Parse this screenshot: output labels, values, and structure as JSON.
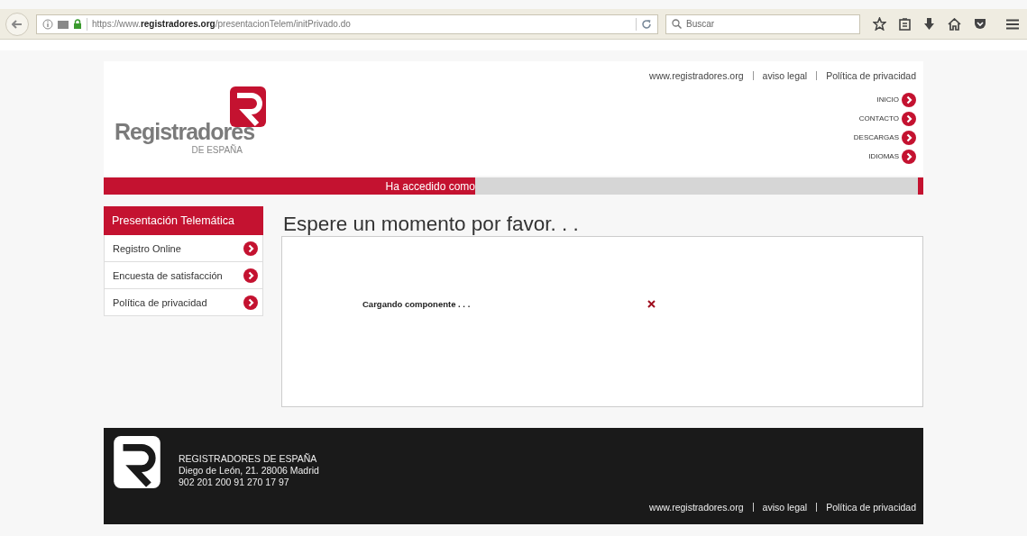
{
  "browser": {
    "url": "https://www.**registradores.org**/presentacionTelem/initPrivado.do",
    "search": {
      "placeholder": "Buscar"
    }
  },
  "header": {
    "top_links": [
      "www.registradores.org",
      "aviso legal",
      "Política de privacidad"
    ],
    "logo": {
      "name": "Registradores",
      "subtitle": "DE ESPAÑA"
    },
    "nav": [
      "INICIO",
      "CONTACTO",
      "DESCARGAS",
      "IDIOMAS"
    ],
    "session_bar": {
      "label": "Ha accedido como"
    }
  },
  "sidebar": {
    "title": "Presentación Telemática",
    "items": [
      "Registro Online",
      "Encuesta de satisfacción",
      "Política de privacidad"
    ]
  },
  "main": {
    "title": "Espere un momento por favor. . .",
    "loading_text": "Cargando componente . . ."
  },
  "footer": {
    "lines": [
      "REGISTRADORES DE ESPAÑA",
      "Diego de León, 21. 28006 Madrid",
      "902 201 200 91 270 17 97"
    ],
    "links": [
      "www.registradores.org",
      "aviso legal",
      "Política de privacidad"
    ]
  }
}
